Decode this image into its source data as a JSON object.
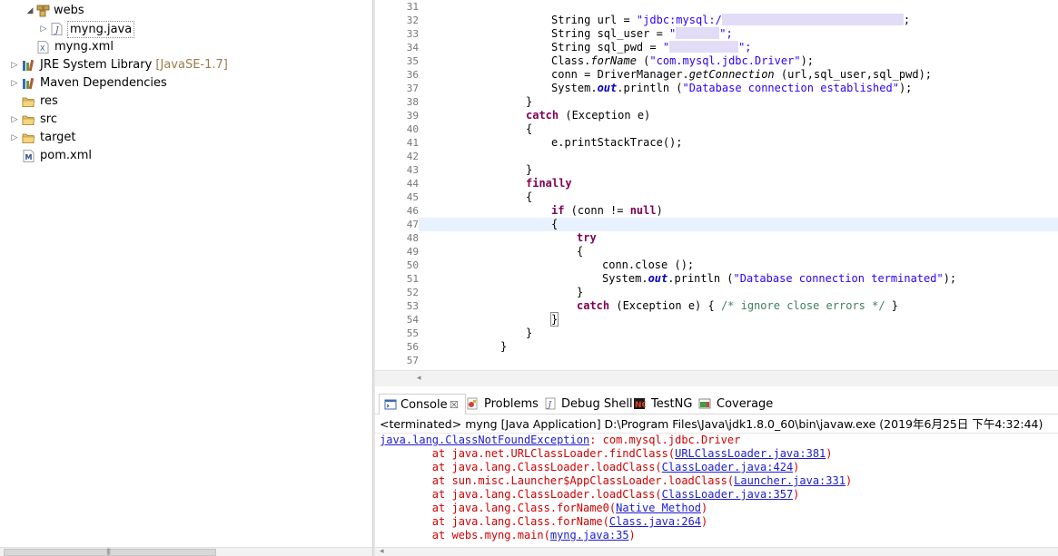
{
  "explorer": {
    "items": [
      {
        "label": "webs",
        "expanded": true,
        "icon": "package-icon"
      },
      {
        "label": "myng.java",
        "expanded": false,
        "icon": "java-file-icon"
      },
      {
        "label": "myng.xml",
        "icon": "xml-file-icon"
      },
      {
        "label": "JRE System Library",
        "decoration": "[JavaSE-1.7]",
        "expanded": false,
        "icon": "library-icon"
      },
      {
        "label": "Maven Dependencies",
        "expanded": false,
        "icon": "library-icon"
      },
      {
        "label": "res",
        "icon": "folder-icon"
      },
      {
        "label": "src",
        "expanded": false,
        "icon": "folder-icon"
      },
      {
        "label": "target",
        "expanded": false,
        "icon": "folder-icon"
      },
      {
        "label": "pom.xml",
        "icon": "maven-file-icon"
      }
    ]
  },
  "editor": {
    "line_numbers": [
      "31",
      "32",
      "33",
      "34",
      "35",
      "36",
      "37",
      "38",
      "39",
      "40",
      "41",
      "42",
      "43",
      "44",
      "45",
      "46",
      "47",
      "48",
      "49",
      "50",
      "51",
      "52",
      "53",
      "54",
      "55",
      "56",
      "57"
    ],
    "current_line": "47",
    "code": {
      "l32_a": "String url = ",
      "l32_str": "\"jdbc:mysql:/",
      "l32_end": ";",
      "l33_a": "String sql_user = ",
      "l33_str": "\"",
      "l33_end": "\";",
      "l34_a": "String sql_pwd = ",
      "l34_str": "\"",
      "l34_end": "\";",
      "l35_a": "Class.",
      "l35_m": "forName",
      "l35_b": " (",
      "l35_str": "\"com.mysql.jdbc.Driver\"",
      "l35_c": ");",
      "l36_a": "conn = DriverManager.",
      "l36_m": "getConnection",
      "l36_b": " (url,sql_user,sql_pwd);",
      "l37_a": "System.",
      "l37_f": "out",
      "l37_b": ".println (",
      "l37_str": "\"Database connection established\"",
      "l37_c": ");",
      "l38": "}",
      "l39_kw": "catch",
      "l39_b": " (Exception e)",
      "l40": "{",
      "l41": "e.printStackTrace();",
      "l43": "}",
      "l44_kw": "finally",
      "l45": "{",
      "l46_kw": "if",
      "l46_b": " (conn != ",
      "l46_kw2": "null",
      "l46_c": ")",
      "l47": "{",
      "l48_kw": "try",
      "l49": "{",
      "l50": "conn.close ();",
      "l51_a": "System.",
      "l51_f": "out",
      "l51_b": ".println (",
      "l51_str": "\"Database connection terminated\"",
      "l51_c": ");",
      "l52": "}",
      "l53_kw": "catch",
      "l53_b": " (Exception e) { ",
      "l53_cmt": "/* ignore close errors */",
      "l53_c": " }",
      "l54": "}",
      "l55": "}",
      "l56": "}"
    }
  },
  "console": {
    "tabs": [
      {
        "label": "Console",
        "icon": "console-icon",
        "active": true
      },
      {
        "label": "Problems",
        "icon": "problems-icon"
      },
      {
        "label": "Debug Shell",
        "icon": "debug-shell-icon"
      },
      {
        "label": "TestNG",
        "icon": "testng-icon"
      },
      {
        "label": "Coverage",
        "icon": "coverage-icon"
      }
    ],
    "close_glyph": "☒",
    "status": "<terminated> myng [Java Application] D:\\Program Files\\Java\\jdk1.8.0_60\\bin\\javaw.exe (2019年6月25日 下午4:32:44)",
    "exception_link": "java.lang.ClassNotFoundException",
    "exception_msg": ": com.mysql.jdbc.Driver",
    "stack": [
      {
        "prefix": "\tat java.net.URLClassLoader.findClass(",
        "link": "URLClassLoader.java:381",
        "suffix": ")"
      },
      {
        "prefix": "\tat java.lang.ClassLoader.loadClass(",
        "link": "ClassLoader.java:424",
        "suffix": ")"
      },
      {
        "prefix": "\tat sun.misc.Launcher$AppClassLoader.loadClass(",
        "link": "Launcher.java:331",
        "suffix": ")"
      },
      {
        "prefix": "\tat java.lang.ClassLoader.loadClass(",
        "link": "ClassLoader.java:357",
        "suffix": ")"
      },
      {
        "prefix": "\tat java.lang.Class.forName0(",
        "link": "Native Method",
        "suffix": ")"
      },
      {
        "prefix": "\tat java.lang.Class.forName(",
        "link": "Class.java:264",
        "suffix": ")"
      },
      {
        "prefix": "\tat webs.myng.main(",
        "link": "myng.java:35",
        "suffix": ")"
      }
    ]
  },
  "scroll": {
    "grip": "|||",
    "left_arrow": "◂"
  },
  "colors": {
    "keyword": "#7f0055",
    "string": "#2a00ff",
    "field": "#0000c0",
    "comment": "#3f7f5f",
    "error": "#d00000",
    "link": "#1c1cd0",
    "current_line": "#e8f2fe"
  }
}
